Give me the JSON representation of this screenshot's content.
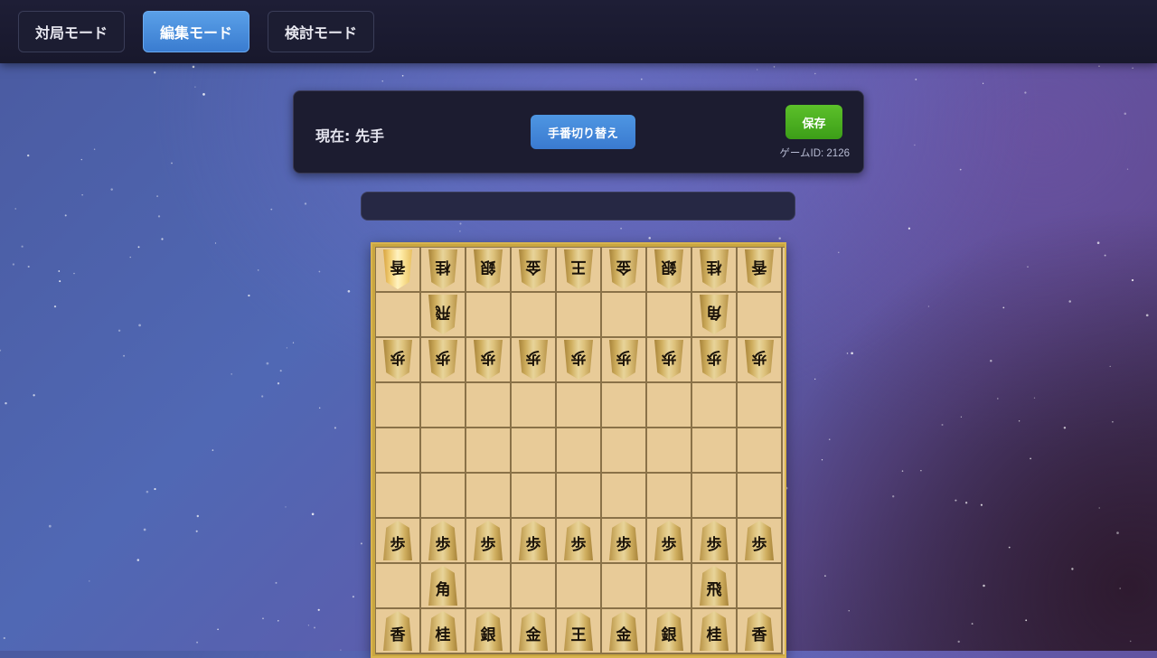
{
  "modes": [
    {
      "label": "対局モード",
      "active": false
    },
    {
      "label": "編集モード",
      "active": true
    },
    {
      "label": "検討モード",
      "active": false
    }
  ],
  "panel": {
    "turn_label": "現在: 先手",
    "switch_label": "手番切り替え",
    "save_label": "保存",
    "game_id": "ゲームID: 2126"
  },
  "message": "",
  "board": {
    "rows": [
      [
        "g:香",
        "g:桂",
        "g:銀",
        "g:金",
        "g:王",
        "g:金",
        "g:銀",
        "g:桂",
        "g:香"
      ],
      [
        "",
        "g:飛",
        "",
        "",
        "",
        "",
        "",
        "g:角",
        ""
      ],
      [
        "g:歩",
        "g:歩",
        "g:歩",
        "g:歩",
        "g:歩",
        "g:歩",
        "g:歩",
        "g:歩",
        "g:歩"
      ],
      [
        "",
        "",
        "",
        "",
        "",
        "",
        "",
        "",
        ""
      ],
      [
        "",
        "",
        "",
        "",
        "",
        "",
        "",
        "",
        ""
      ],
      [
        "",
        "",
        "",
        "",
        "",
        "",
        "",
        "",
        ""
      ],
      [
        "s:歩",
        "s:歩",
        "s:歩",
        "s:歩",
        "s:歩",
        "s:歩",
        "s:歩",
        "s:歩",
        "s:歩"
      ],
      [
        "",
        "s:角",
        "",
        "",
        "",
        "",
        "",
        "s:飛",
        ""
      ],
      [
        "s:香",
        "s:桂",
        "s:銀",
        "s:金",
        "s:王",
        "s:金",
        "s:銀",
        "s:桂",
        "s:香"
      ]
    ],
    "selected": [
      0,
      0
    ]
  }
}
